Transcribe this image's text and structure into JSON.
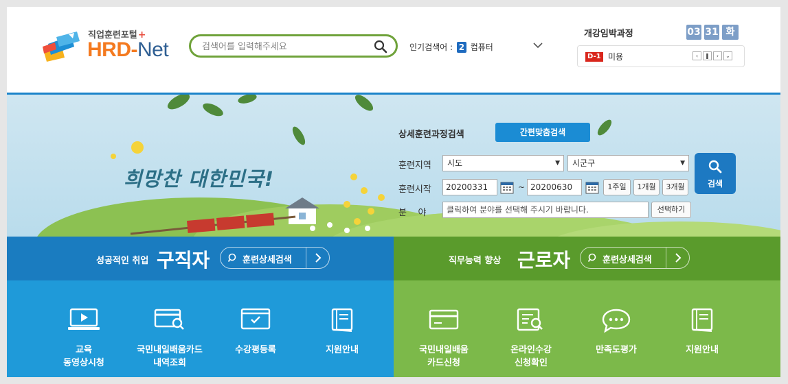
{
  "header": {
    "logo_sub": "직업훈련포털",
    "logo_plus": "+",
    "logo_hrd": "HRD-",
    "logo_net": "Net",
    "search_placeholder": "검색어를 입력해주세요",
    "popular_label": "인기검색어 :",
    "popular_rank": "2",
    "popular_term": "컴퓨터",
    "deadline_title": "개강임박과정",
    "date_month": "03",
    "date_day": "31",
    "date_weekday": "화",
    "deadline_tag": "D-1",
    "deadline_course": "미용"
  },
  "banner": {
    "slogan": "희망찬 대한민국!",
    "search_title": "상세훈련과정검색",
    "quick_search": "간편맞춤검색",
    "region_label": "훈련지역",
    "region_sido": "시도",
    "region_sigungu": "시군구",
    "start_label": "훈련시작",
    "date_from": "20200331",
    "date_tilde": "~",
    "date_to": "20200630",
    "period_1w": "1주일",
    "period_1m": "1개월",
    "period_3m": "3개월",
    "field_label": "분    야",
    "field_placeholder": "클릭하여 분야를 선택해 주시기 바랍니다.",
    "choose_btn": "선택하기",
    "search_btn": "검색"
  },
  "job_seeker": {
    "sub": "성공적인 취업",
    "title": "구직자",
    "pill": "훈련상세검색",
    "items": [
      {
        "label": "교육\n동영상시청",
        "icon": "monitor-play-icon"
      },
      {
        "label": "국민내일배움카드\n내역조회",
        "icon": "card-search-icon"
      },
      {
        "label": "수강평등록",
        "icon": "review-window-icon"
      },
      {
        "label": "지원안내",
        "icon": "book-icon"
      }
    ]
  },
  "worker": {
    "sub": "직무능력 향상",
    "title": "근로자",
    "pill": "훈련상세검색",
    "items": [
      {
        "label": "국민내일배움\n카드신청",
        "icon": "card-icon"
      },
      {
        "label": "온라인수강\n신청확인",
        "icon": "document-search-icon"
      },
      {
        "label": "만족도평가",
        "icon": "chat-bubble-icon"
      },
      {
        "label": "지원안내",
        "icon": "book-icon"
      }
    ]
  },
  "colors": {
    "blue_head": "#1a7cc0",
    "blue_body": "#1f9ad9",
    "green_head": "#5a9b2c",
    "green_body": "#7cb94a",
    "accent_orange": "#f47a20"
  }
}
